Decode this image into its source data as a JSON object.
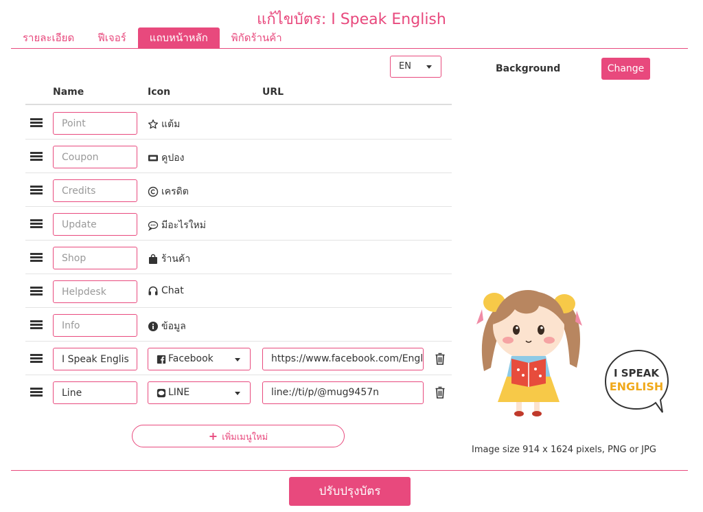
{
  "page": {
    "title": "แก้ไขบัตร: I Speak English"
  },
  "tabs": [
    {
      "label": "รายละเอียด",
      "active": false
    },
    {
      "label": "ฟีเจอร์",
      "active": false
    },
    {
      "label": "แถบหน้าหลัก",
      "active": true
    },
    {
      "label": "พิกัดร้านค้า",
      "active": false
    }
  ],
  "language": {
    "selected": "EN"
  },
  "table": {
    "headers": {
      "name": "Name",
      "icon": "Icon",
      "url": "URL"
    },
    "rows": [
      {
        "name_placeholder": "Point",
        "icon": "star-icon",
        "icon_label": "แต้ม"
      },
      {
        "name_placeholder": "Coupon",
        "icon": "ticket-icon",
        "icon_label": "คูปอง"
      },
      {
        "name_placeholder": "Credits",
        "icon": "copyright-icon",
        "icon_label": "เครดิต"
      },
      {
        "name_placeholder": "Update",
        "icon": "comment-icon",
        "icon_label": "มีอะไรใหม่"
      },
      {
        "name_placeholder": "Shop",
        "icon": "shopping-bag-icon",
        "icon_label": "ร้านค้า"
      },
      {
        "name_placeholder": "Helpdesk",
        "icon": "headphones-icon",
        "icon_label": "Chat"
      },
      {
        "name_placeholder": "Info",
        "icon": "info-icon",
        "icon_label": "ข้อมูล"
      },
      {
        "name_value": "I Speak English",
        "icon": "facebook-icon",
        "icon_select": "Facebook",
        "url": "https://www.facebook.com/EnglishSpeak"
      },
      {
        "name_value": "Line",
        "icon": "line-icon",
        "icon_select": "LINE",
        "url": "line://ti/p/@mug9457n"
      }
    ]
  },
  "add_menu_label": "เพิ่มเมนูใหม่",
  "background": {
    "label": "Background",
    "change_label": "Change",
    "image_text_line1": "I SPEAK",
    "image_text_line2": "ENGLISH",
    "size_note": "Image size 914 x 1624 pixels, PNG or JPG"
  },
  "submit_label": "ปรับปรุงบัตร",
  "colors": {
    "accent": "#e8497d",
    "brand_orange": "#f0a91b"
  }
}
